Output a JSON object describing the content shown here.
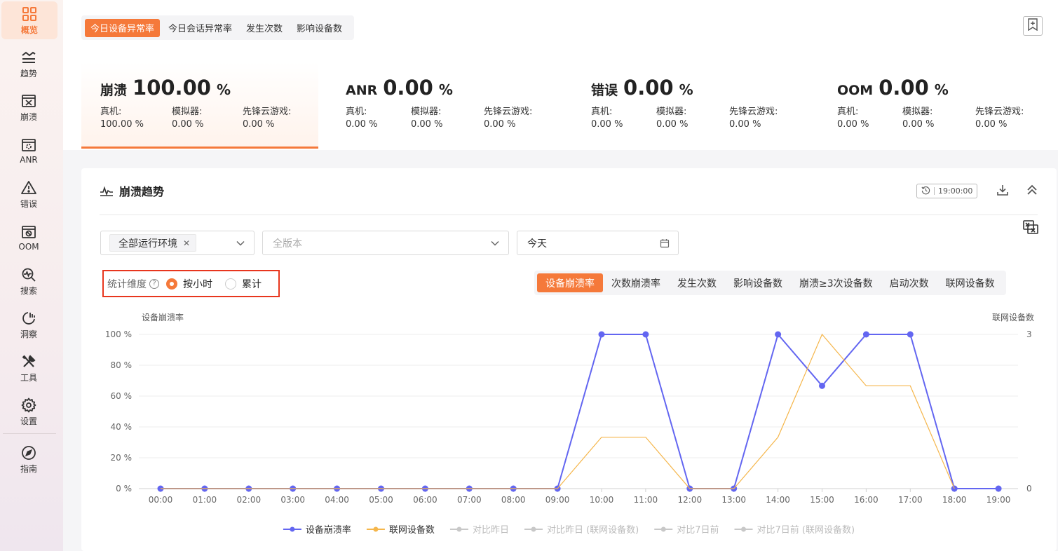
{
  "sidebar": {
    "items": [
      {
        "label": "概览",
        "icon": "grid-icon",
        "active": true
      },
      {
        "label": "趋势",
        "icon": "trend-icon"
      },
      {
        "label": "崩溃",
        "icon": "crash-window-icon"
      },
      {
        "label": "ANR",
        "icon": "anr-window-icon"
      },
      {
        "label": "错误",
        "icon": "warning-icon"
      },
      {
        "label": "OOM",
        "icon": "oom-window-icon"
      },
      {
        "label": "搜索",
        "icon": "search-pulse-icon"
      },
      {
        "label": "洞察",
        "icon": "insight-chart-icon"
      },
      {
        "label": "工具",
        "icon": "tools-icon"
      },
      {
        "label": "设置",
        "icon": "gear-icon"
      },
      {
        "label": "指南",
        "icon": "compass-icon"
      }
    ]
  },
  "top_tabs": [
    {
      "label": "今日设备异常率",
      "active": true
    },
    {
      "label": "今日会话异常率"
    },
    {
      "label": "发生次数"
    },
    {
      "label": "影响设备数"
    }
  ],
  "metrics": [
    {
      "name": "崩溃",
      "value": "100.00",
      "unit": "%",
      "active": true,
      "subs": [
        {
          "label": "真机:",
          "value": "100.00 %"
        },
        {
          "label": "模拟器:",
          "value": "0.00 %"
        },
        {
          "label": "先锋云游戏:",
          "value": "0.00 %"
        }
      ]
    },
    {
      "name": "ANR",
      "value": "0.00",
      "unit": "%",
      "subs": [
        {
          "label": "真机:",
          "value": "0.00 %"
        },
        {
          "label": "模拟器:",
          "value": "0.00 %"
        },
        {
          "label": "先锋云游戏:",
          "value": "0.00 %"
        }
      ]
    },
    {
      "name": "错误",
      "value": "0.00",
      "unit": "%",
      "subs": [
        {
          "label": "真机:",
          "value": "0.00 %"
        },
        {
          "label": "模拟器:",
          "value": "0.00 %"
        },
        {
          "label": "先锋云游戏:",
          "value": "0.00 %"
        }
      ]
    },
    {
      "name": "OOM",
      "value": "0.00",
      "unit": "%",
      "subs": [
        {
          "label": "真机:",
          "value": "0.00 %"
        },
        {
          "label": "模拟器:",
          "value": "0.00 %"
        },
        {
          "label": "先锋云游戏:",
          "value": "0.00 %"
        }
      ]
    }
  ],
  "trend": {
    "title": "崩溃趋势",
    "time_badge": "19:00:00",
    "filters": {
      "env_chip": "全部运行环境",
      "version_placeholder": "全版本",
      "date": "今天"
    },
    "dimension": {
      "label": "统计维度",
      "options": [
        {
          "label": "按小时",
          "checked": true
        },
        {
          "label": "累计",
          "checked": false
        }
      ]
    },
    "metric_tabs": [
      {
        "label": "设备崩溃率",
        "active": true
      },
      {
        "label": "次数崩溃率"
      },
      {
        "label": "发生次数"
      },
      {
        "label": "影响设备数"
      },
      {
        "label": "崩溃≥3次设备数"
      },
      {
        "label": "启动次数"
      },
      {
        "label": "联网设备数"
      }
    ]
  },
  "chart_data": {
    "type": "line",
    "ylabel": "设备崩溃率",
    "y2label": "联网设备数",
    "ylim": [
      0,
      100
    ],
    "y2lim": [
      0,
      3
    ],
    "yticks": [
      "0 %",
      "20 %",
      "40 %",
      "60 %",
      "80 %",
      "100 %"
    ],
    "y2ticks": [
      "0",
      "3"
    ],
    "categories": [
      "00:00",
      "01:00",
      "02:00",
      "03:00",
      "04:00",
      "05:00",
      "06:00",
      "07:00",
      "08:00",
      "09:00",
      "10:00",
      "11:00",
      "12:00",
      "13:00",
      "14:00",
      "15:00",
      "16:00",
      "17:00",
      "18:00",
      "19:00"
    ],
    "series": [
      {
        "name": "设备崩溃率",
        "axis": "left",
        "color": "#6366f1",
        "values": [
          0,
          0,
          0,
          0,
          0,
          0,
          0,
          0,
          0,
          0,
          100,
          100,
          0,
          0,
          100,
          66.67,
          100,
          100,
          0,
          0
        ]
      },
      {
        "name": "联网设备数",
        "axis": "right",
        "color": "#f5b64b",
        "values": [
          0,
          0,
          0,
          0,
          0,
          0,
          0,
          0,
          0,
          0,
          1,
          1,
          0,
          0,
          1,
          3,
          2,
          2,
          0,
          null
        ]
      }
    ],
    "legend": [
      {
        "name": "设备崩溃率",
        "color": "#6366f1",
        "enabled": true
      },
      {
        "name": "联网设备数",
        "color": "#f5b64b",
        "enabled": true
      },
      {
        "name": "对比昨日",
        "color": "#c8c8c8",
        "enabled": false
      },
      {
        "name": "对比昨日 (联网设备数)",
        "color": "#c8c8c8",
        "enabled": false
      },
      {
        "name": "对比7日前",
        "color": "#c8c8c8",
        "enabled": false
      },
      {
        "name": "对比7日前 (联网设备数)",
        "color": "#c8c8c8",
        "enabled": false
      }
    ],
    "grid": true,
    "legend_position": "bottom-center"
  }
}
